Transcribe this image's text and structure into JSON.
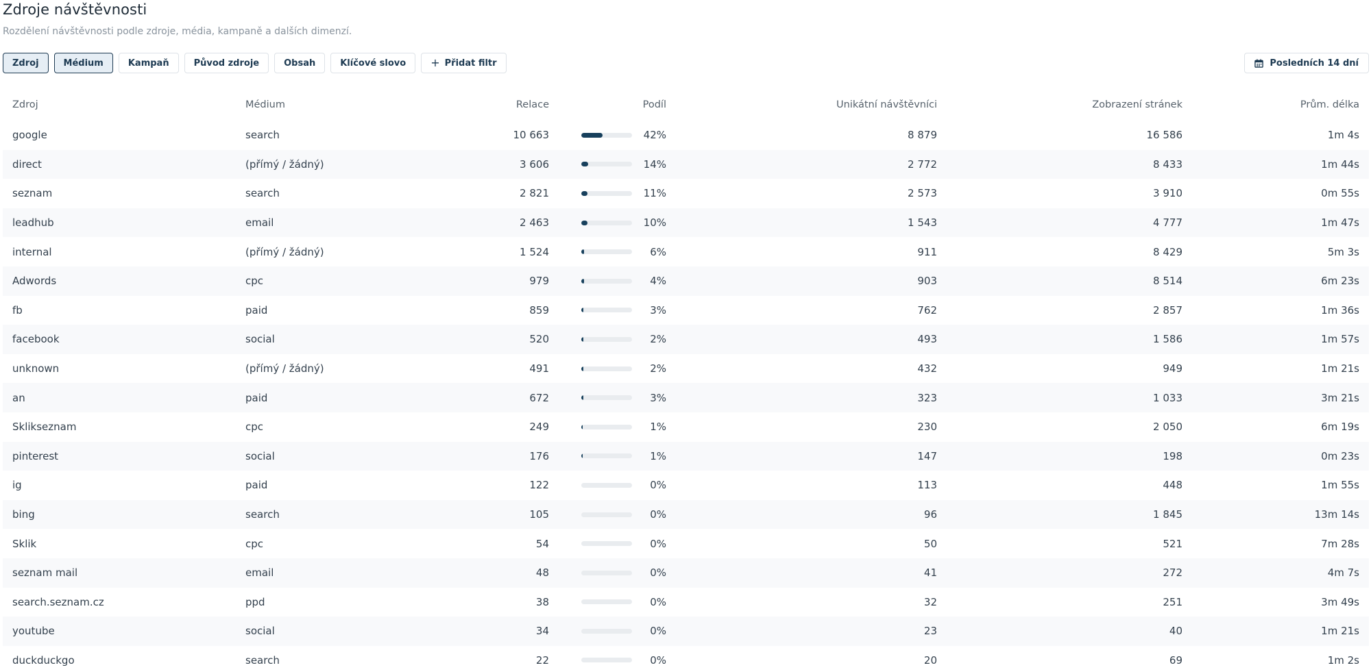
{
  "title": "Zdroje návštěvnosti",
  "subtitle": "Rozdělení návštěvnosti podle zdroje, média, kampaně a dalších dimenzí.",
  "filters": [
    {
      "label": "Zdroj",
      "active": true
    },
    {
      "label": "Médium",
      "active": true
    },
    {
      "label": "Kampaň",
      "active": false
    },
    {
      "label": "Původ zdroje",
      "active": false
    },
    {
      "label": "Obsah",
      "active": false
    },
    {
      "label": "Klíčové slovo",
      "active": false
    }
  ],
  "add_filter": {
    "icon": "plus-icon",
    "label": "Přidat filtr"
  },
  "date_range": {
    "icon": "calendar-icon",
    "label": "Posledních 14 dní"
  },
  "colors": {
    "accent": "#17405c",
    "track": "#e9ecef",
    "active_chip_bg": "#e6eef5"
  },
  "table": {
    "columns": [
      "Zdroj",
      "Médium",
      "Relace",
      "Podíl",
      "Unikátní návštěvníci",
      "Zobrazení stránek",
      "Prům. délka"
    ],
    "rows": [
      {
        "source": "google",
        "medium": "search",
        "sessions": "10 663",
        "share": "42%",
        "share_value": 42,
        "visitors": "8 879",
        "views": "16 586",
        "duration": "1m 4s"
      },
      {
        "source": "direct",
        "medium": "(přímý / žádný)",
        "sessions": "3 606",
        "share": "14%",
        "share_value": 14,
        "visitors": "2 772",
        "views": "8 433",
        "duration": "1m 44s"
      },
      {
        "source": "seznam",
        "medium": "search",
        "sessions": "2 821",
        "share": "11%",
        "share_value": 11,
        "visitors": "2 573",
        "views": "3 910",
        "duration": "0m 55s"
      },
      {
        "source": "leadhub",
        "medium": "email",
        "sessions": "2 463",
        "share": "10%",
        "share_value": 10,
        "visitors": "1 543",
        "views": "4 777",
        "duration": "1m 47s"
      },
      {
        "source": "internal",
        "medium": "(přímý / žádný)",
        "sessions": "1 524",
        "share": "6%",
        "share_value": 6,
        "visitors": "911",
        "views": "8 429",
        "duration": "5m 3s"
      },
      {
        "source": "Adwords",
        "medium": "cpc",
        "sessions": "979",
        "share": "4%",
        "share_value": 4,
        "visitors": "903",
        "views": "8 514",
        "duration": "6m 23s"
      },
      {
        "source": "fb",
        "medium": "paid",
        "sessions": "859",
        "share": "3%",
        "share_value": 3,
        "visitors": "762",
        "views": "2 857",
        "duration": "1m 36s"
      },
      {
        "source": "facebook",
        "medium": "social",
        "sessions": "520",
        "share": "2%",
        "share_value": 2,
        "visitors": "493",
        "views": "1 586",
        "duration": "1m 57s"
      },
      {
        "source": "unknown",
        "medium": "(přímý / žádný)",
        "sessions": "491",
        "share": "2%",
        "share_value": 2,
        "visitors": "432",
        "views": "949",
        "duration": "1m 21s"
      },
      {
        "source": "an",
        "medium": "paid",
        "sessions": "672",
        "share": "3%",
        "share_value": 3,
        "visitors": "323",
        "views": "1 033",
        "duration": "3m 21s"
      },
      {
        "source": "Sklikseznam",
        "medium": "cpc",
        "sessions": "249",
        "share": "1%",
        "share_value": 1,
        "visitors": "230",
        "views": "2 050",
        "duration": "6m 19s"
      },
      {
        "source": "pinterest",
        "medium": "social",
        "sessions": "176",
        "share": "1%",
        "share_value": 1,
        "visitors": "147",
        "views": "198",
        "duration": "0m 23s"
      },
      {
        "source": "ig",
        "medium": "paid",
        "sessions": "122",
        "share": "0%",
        "share_value": 0,
        "visitors": "113",
        "views": "448",
        "duration": "1m 55s"
      },
      {
        "source": "bing",
        "medium": "search",
        "sessions": "105",
        "share": "0%",
        "share_value": 0,
        "visitors": "96",
        "views": "1 845",
        "duration": "13m 14s"
      },
      {
        "source": "Sklik",
        "medium": "cpc",
        "sessions": "54",
        "share": "0%",
        "share_value": 0,
        "visitors": "50",
        "views": "521",
        "duration": "7m 28s"
      },
      {
        "source": "seznam mail",
        "medium": "email",
        "sessions": "48",
        "share": "0%",
        "share_value": 0,
        "visitors": "41",
        "views": "272",
        "duration": "4m 7s"
      },
      {
        "source": "search.seznam.cz",
        "medium": "ppd",
        "sessions": "38",
        "share": "0%",
        "share_value": 0,
        "visitors": "32",
        "views": "251",
        "duration": "3m 49s"
      },
      {
        "source": "youtube",
        "medium": "social",
        "sessions": "34",
        "share": "0%",
        "share_value": 0,
        "visitors": "23",
        "views": "40",
        "duration": "1m 21s"
      },
      {
        "source": "duckduckgo",
        "medium": "search",
        "sessions": "22",
        "share": "0%",
        "share_value": 0,
        "visitors": "20",
        "views": "69",
        "duration": "1m 2s"
      }
    ]
  }
}
